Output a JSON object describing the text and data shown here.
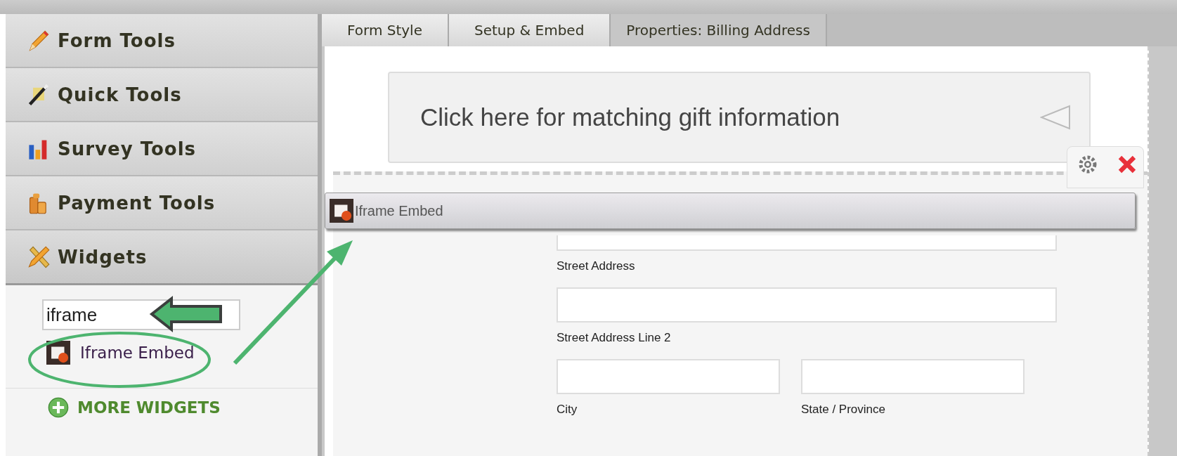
{
  "sidebar": {
    "sections": [
      {
        "kind": "pencil",
        "label": "Form Tools",
        "expanded": false
      },
      {
        "kind": "wand",
        "label": "Quick Tools",
        "expanded": false
      },
      {
        "kind": "chart",
        "label": "Survey Tools",
        "expanded": false
      },
      {
        "kind": "coins",
        "label": "Payment Tools",
        "expanded": false
      },
      {
        "kind": "tools",
        "label": "Widgets",
        "expanded": true
      }
    ],
    "search": {
      "value": "iframe"
    },
    "results": [
      {
        "label": "Iframe Embed"
      }
    ],
    "more_widgets": "MORE WIDGETS"
  },
  "tabs": [
    {
      "label": "Form Style",
      "selected": false
    },
    {
      "label": "Setup & Embed",
      "selected": false
    },
    {
      "label": "Properties: Billing Address",
      "selected": true
    }
  ],
  "banner": {
    "text": "Click here for matching gift information"
  },
  "drag_item": {
    "label": "Iframe Embed"
  },
  "address_fields": [
    {
      "label": "Street Address",
      "wide": true
    },
    {
      "label": "Street Address Line 2",
      "wide": true
    },
    {
      "label": "City",
      "wide": false
    },
    {
      "label": "State / Province",
      "wide": false
    }
  ]
}
